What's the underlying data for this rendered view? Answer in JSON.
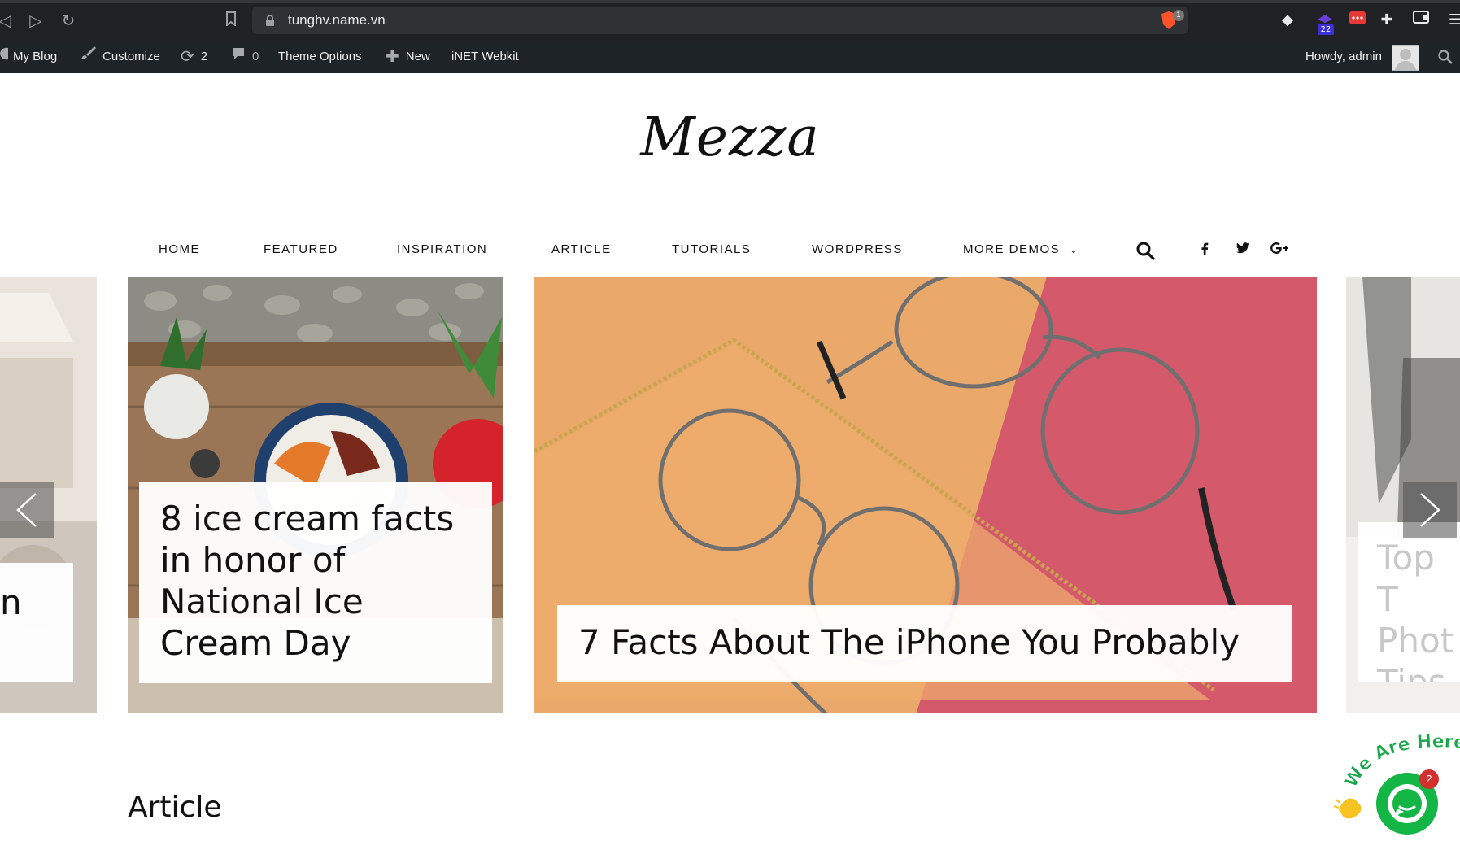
{
  "browser": {
    "url": "tunghv.name.vn",
    "brave_badge": "1",
    "ext_badge": "22"
  },
  "adminbar": {
    "site": "My Blog",
    "customize": "Customize",
    "updates_count": "2",
    "comments_count": "0",
    "theme_options": "Theme Options",
    "new": "New",
    "webkit": "iNET Webkit",
    "howdy": "Howdy, admin"
  },
  "site": {
    "logo": "Mezza"
  },
  "nav": {
    "items": [
      "HOME",
      "FEATURED",
      "INSPIRATION",
      "ARTICLE",
      "TUTORIALS",
      "WORDPRESS",
      "MORE DEMOS"
    ],
    "dropdown_marker": "⌄"
  },
  "slider": {
    "left_partial_caption": "n",
    "slide1_title": "8 ice cream facts in honor of National Ice Cream Day",
    "slide2_title": "7 Facts About The iPhone You Probably",
    "right_partial_caption": "Top T Phot Tips"
  },
  "sections": {
    "article_title": "Article"
  },
  "chat": {
    "badge": "2",
    "label": "We Are Here!"
  },
  "colors": {
    "browser_bg": "#202124",
    "adminbar_bg": "#1d2327",
    "chat_green": "#13b545",
    "badge_red": "#d32f2f"
  }
}
